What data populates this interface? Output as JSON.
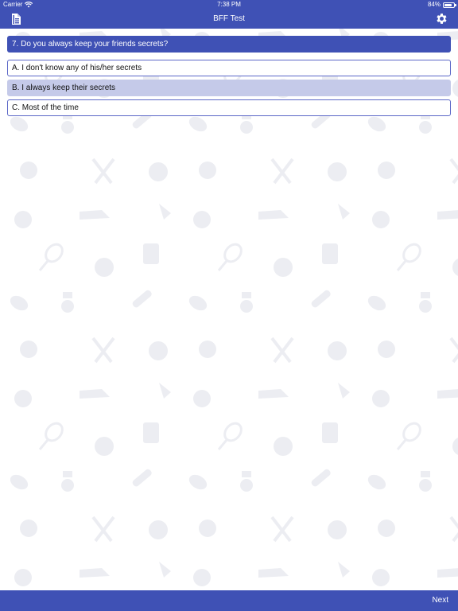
{
  "status_bar": {
    "carrier": "Carrier",
    "time": "7:38 PM",
    "battery": "84%",
    "battery_level": 0.84
  },
  "nav_bar": {
    "title": "BFF Test",
    "left_icon": "document-icon",
    "right_icon": "gear-icon"
  },
  "quiz": {
    "question": "7. Do you always keep your friends secrets?",
    "answers": [
      {
        "label": "A. I don't know any of his/her secrets",
        "selected": false
      },
      {
        "label": "B. I always keep their secrets",
        "selected": true
      },
      {
        "label": "C. Most of the time",
        "selected": false
      }
    ]
  },
  "bottom_bar": {
    "next_label": "Next"
  },
  "colors": {
    "primary": "#3f51b5",
    "selected_answer": "#c5cae9",
    "answer_border": "#5b67c7",
    "pattern": "#ecedf2"
  }
}
